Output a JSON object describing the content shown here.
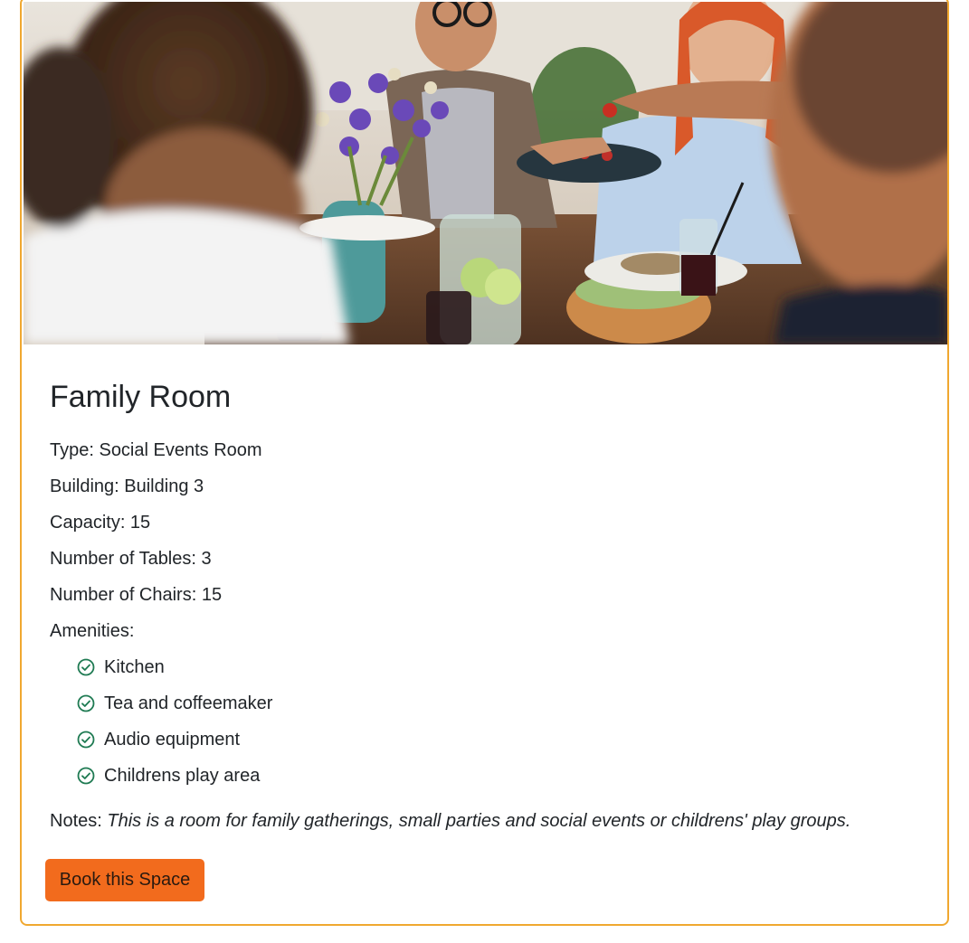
{
  "room": {
    "title": "Family Room",
    "photo_alt": "People sharing a meal around a table",
    "type_line": "Type: Social Events Room",
    "building_line": "Building: Building 3",
    "capacity_line": "Capacity: 15",
    "tables_line": "Number of Tables: 3",
    "chairs_line": "Number of Chairs: 15",
    "amenities_label": "Amenities:",
    "amenities": [
      {
        "label": "Kitchen",
        "icon": "check-circle-icon"
      },
      {
        "label": "Tea and coffeemaker",
        "icon": "check-circle-icon"
      },
      {
        "label": "Audio equipment",
        "icon": "check-circle-icon"
      },
      {
        "label": "Childrens play area",
        "icon": "check-circle-icon"
      }
    ],
    "notes_label": "Notes: ",
    "notes_text": "This is a room for family gatherings, small parties and social events or childrens' play groups."
  },
  "actions": {
    "book_label": "Book this Space"
  },
  "colors": {
    "card_border": "#f0a830",
    "button_bg": "#f26b1d",
    "check_icon": "#1e7a52"
  }
}
